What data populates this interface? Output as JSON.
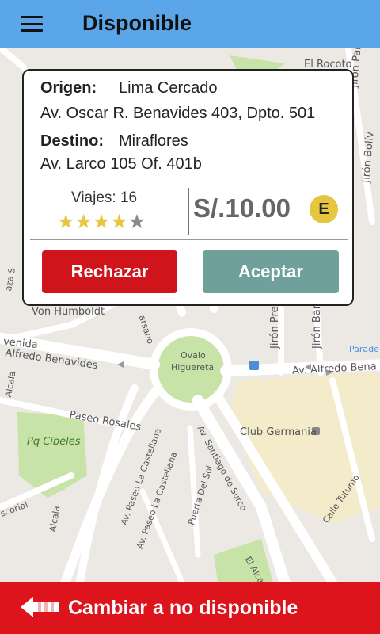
{
  "app_bar": {
    "title": "Disponible",
    "menu_icon": "hamburger-menu-icon"
  },
  "request": {
    "origin_label": "Origen:",
    "origin_district": "Lima Cercado",
    "origin_address": "Av. Oscar R. Benavides 403, Dpto. 501",
    "destination_label": "Destino:",
    "destination_district": "Miraflores",
    "destination_address": "Av. Larco 105 Of. 401b",
    "trips_text": "Viajes: 16",
    "rating": 4,
    "rating_max": 5,
    "price": "S/.10.00",
    "payment_badge": "E",
    "reject_label": "Rechazar",
    "accept_label": "Aceptar"
  },
  "map": {
    "labels": {
      "el_rocoto": "El Rocoto",
      "jiron_pane": "Jirón Pane",
      "jiron_bolivar": "Jirón Bolív",
      "jiron_prescott": "Jirón Prescott",
      "jiron_barcelona": "Jirón Barcelona",
      "von_humboldt": "Von Humboldt",
      "avenida": "venida",
      "alfredo_benavides_w": "Alfredo Benavides",
      "alfredo_benavides_e": "Av. Alfredo Bena",
      "ovalo": "Ovalo",
      "higuereta": "Higuereta",
      "paradero": "Parade",
      "club_germania": "Club Germania",
      "paseo_rosales": "Paseo Rosales",
      "pq_cibeles": "Pq Cibeles",
      "la_castellana_1": "Av. Paseo La Castellana",
      "la_castellana_2": "Av. Paseo La Castellana",
      "santiago_de_surco": "Av. Santiago de Surco",
      "puerta_del_sol": "Puerta Del Sol",
      "calle_tutumo": "Calle Tutumo",
      "el_alcazar": "El Alcá",
      "alcala_1": "Alcala",
      "alcala_2": "Alcala",
      "escorial": "scorial",
      "arsano": "arsano",
      "aza_s": "aza S"
    },
    "colors": {
      "background": "#ece9e4",
      "road": "#ffffff",
      "park": "#c8e3a7",
      "area": "#f4ebcb"
    }
  },
  "bottom_bar": {
    "label": "Cambiar a no disponible",
    "arrow_icon": "arrow-left-icon"
  }
}
